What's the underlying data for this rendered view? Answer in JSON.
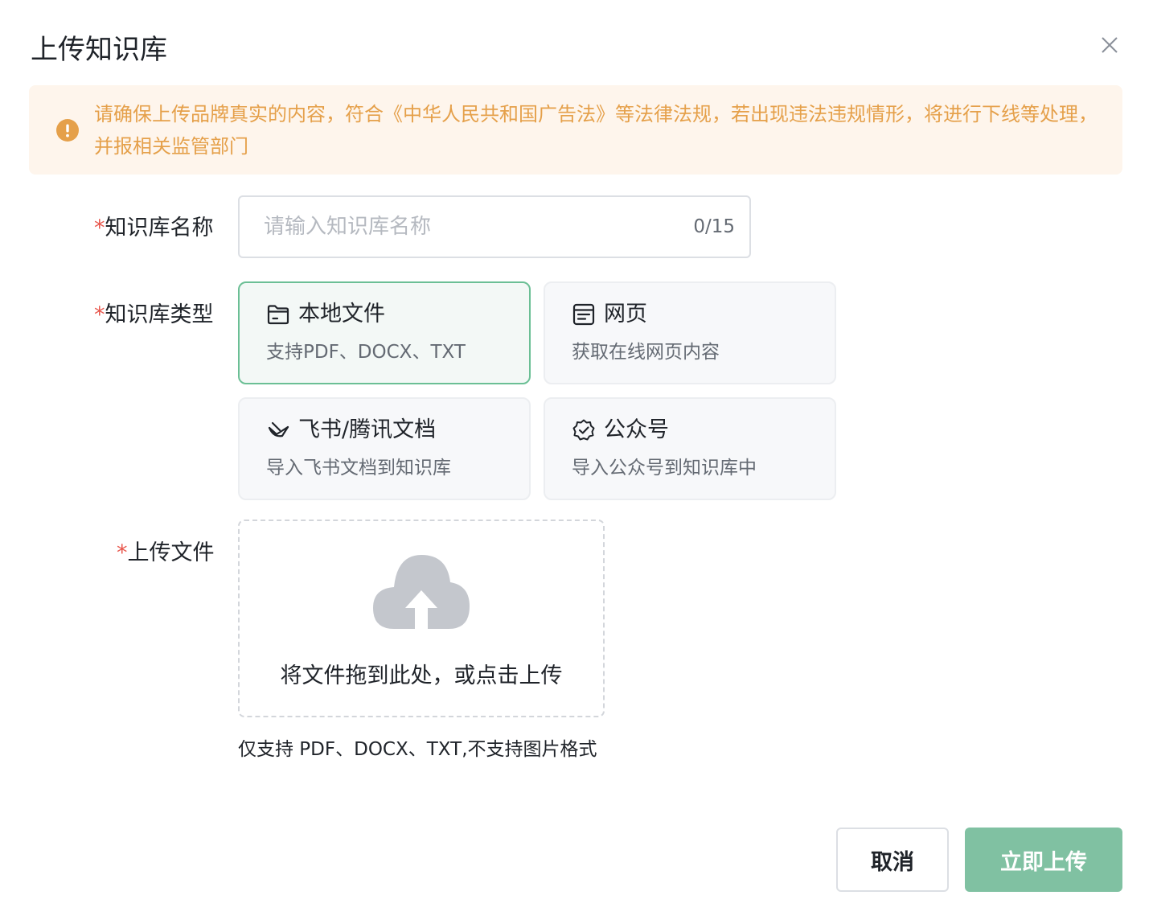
{
  "dialog": {
    "title": "上传知识库",
    "close_icon": "close-icon"
  },
  "alert": {
    "icon": "warning-icon",
    "text": "请确保上传品牌真实的内容，符合《中华人民共和国广告法》等法律法规，若出现违法违规情形，将进行下线等处理，并报相关监管部门",
    "color": "#e5a04a",
    "background": "#fef5ec"
  },
  "form": {
    "required_mark": "*",
    "name": {
      "label": "知识库名称",
      "value": "",
      "placeholder": "请输入知识库名称",
      "counter": "0/15"
    },
    "type": {
      "label": "知识库类型",
      "selected": "local-file",
      "options": [
        {
          "id": "local-file",
          "icon": "folder-icon",
          "title": "本地文件",
          "desc": "支持PDF、DOCX、TXT"
        },
        {
          "id": "webpage",
          "icon": "webpage-icon",
          "title": "网页",
          "desc": "获取在线网页内容"
        },
        {
          "id": "feishu-tencent",
          "icon": "feishu-icon",
          "title": "飞书/腾讯文档",
          "desc": "导入飞书文档到知识库"
        },
        {
          "id": "wechat-official",
          "icon": "badge-check-icon",
          "title": "公众号",
          "desc": "导入公众号到知识库中"
        }
      ]
    },
    "upload": {
      "label": "上传文件",
      "icon": "cloud-upload-icon",
      "drop_text": "将文件拖到此处，或点击上传",
      "hint": "仅支持 PDF、DOCX、TXT,不支持图片格式"
    }
  },
  "footer": {
    "cancel_label": "取消",
    "submit_label": "立即上传"
  },
  "colors": {
    "accent": "#6bbf95",
    "submit_bg": "#80c1a2",
    "required": "#e8574d"
  }
}
